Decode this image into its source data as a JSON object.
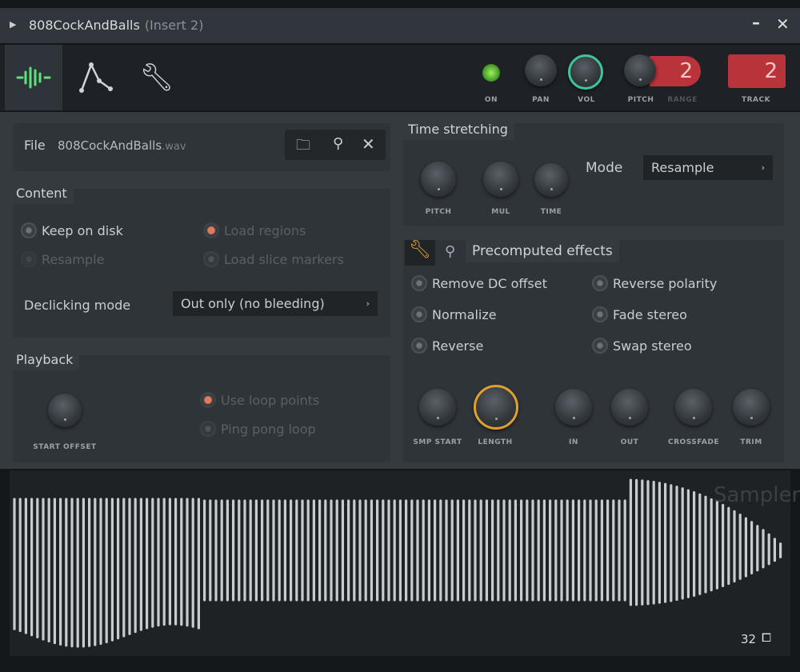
{
  "window": {
    "title": "808CockAndBalls",
    "subtitle": "(Insert 2)",
    "minimize_icon": "minus",
    "close_icon": "x"
  },
  "tabs": [
    {
      "name": "sample-settings",
      "icon": "waveform",
      "active": true
    },
    {
      "name": "envelope",
      "icon": "envelope"
    },
    {
      "name": "misc",
      "icon": "wrench"
    }
  ],
  "controls": {
    "on_label": "ON",
    "pan_label": "PAN",
    "vol_label": "VOL",
    "pitch_label": "PITCH",
    "range_label": "RANGE",
    "range_value": "2",
    "track_label": "TRACK",
    "track_value": "2",
    "on_color": "#7de04a",
    "vol_color": "#3fc59a"
  },
  "file": {
    "label": "File",
    "name": "808CockAndBalls",
    "ext": ".wav"
  },
  "content": {
    "title": "Content",
    "keep_on_disk": "Keep on disk",
    "resample": "Resample",
    "load_regions": "Load regions",
    "load_slice_markers": "Load slice markers",
    "declicking_label": "Declicking mode",
    "declicking_value": "Out only (no bleeding)"
  },
  "playback": {
    "title": "Playback",
    "start_offset": "START OFFSET",
    "use_loop_points": "Use loop points",
    "ping_pong_loop": "Ping pong loop"
  },
  "time_stretching": {
    "title": "Time stretching",
    "pitch": "PITCH",
    "mul": "MUL",
    "time": "TIME",
    "mode_label": "Mode",
    "mode_value": "Resample"
  },
  "precomputed": {
    "title": "Precomputed effects",
    "options": [
      "Remove DC offset",
      "Normalize",
      "Reverse",
      "Reverse polarity",
      "Fade stereo",
      "Swap stereo"
    ],
    "knobs": [
      "SMP START",
      "LENGTH",
      "IN",
      "OUT",
      "CROSSFADE",
      "TRIM"
    ],
    "length_color": "#e0a030"
  },
  "waveform": {
    "watermark": "Sampler",
    "zoom_value": "32"
  }
}
